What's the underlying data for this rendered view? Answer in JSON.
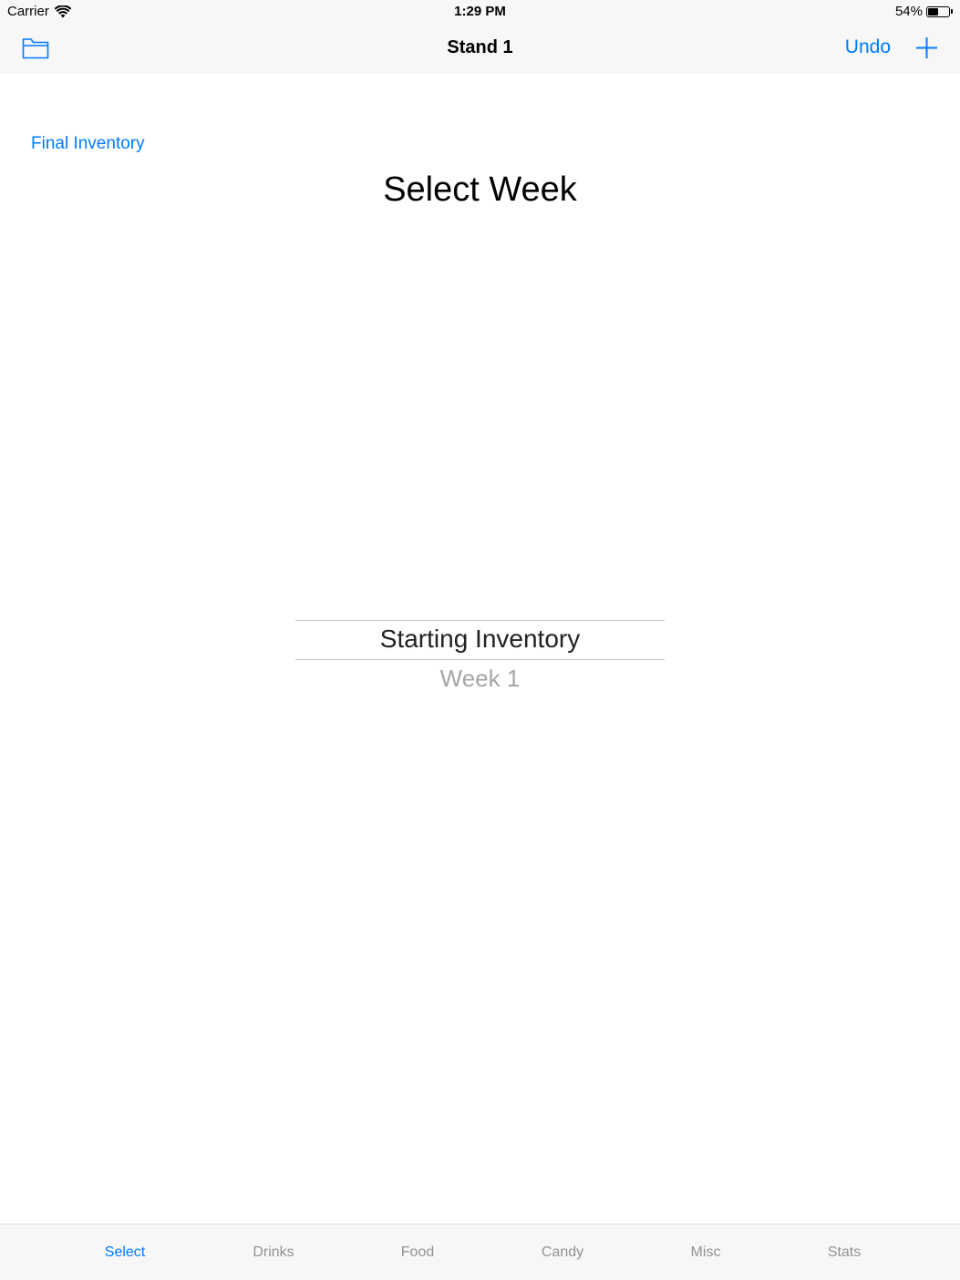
{
  "status_bar": {
    "carrier": "Carrier",
    "time": "1:29 PM",
    "battery_percent": "54%",
    "battery_level": 0.54,
    "wifi_icon": "wifi-icon",
    "battery_icon": "battery-icon"
  },
  "nav": {
    "title": "Stand 1",
    "folder_icon": "folder-icon",
    "undo_label": "Undo",
    "add_icon": "plus-icon"
  },
  "content": {
    "final_inventory_link": "Final Inventory",
    "title": "Select Week"
  },
  "picker": {
    "selected": "Starting Inventory",
    "options": [
      "Week 1"
    ]
  },
  "tabs": [
    {
      "label": "Select",
      "active": true
    },
    {
      "label": "Drinks",
      "active": false
    },
    {
      "label": "Food",
      "active": false
    },
    {
      "label": "Candy",
      "active": false
    },
    {
      "label": "Misc",
      "active": false
    },
    {
      "label": "Stats",
      "active": false
    }
  ],
  "colors": {
    "accent": "#007aff",
    "tab_inactive": "#929292",
    "bar_background": "#f7f7f7"
  }
}
